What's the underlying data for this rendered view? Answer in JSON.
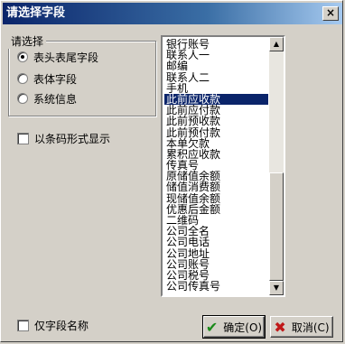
{
  "window": {
    "title": "请选择字段",
    "close_glyph": "×"
  },
  "group": {
    "title": "请选择",
    "options": [
      {
        "label": "表头表尾字段",
        "selected": true
      },
      {
        "label": "表体字段",
        "selected": false
      },
      {
        "label": "系统信息",
        "selected": false
      }
    ]
  },
  "barcode_checkbox": {
    "label": "以条码形式显示",
    "checked": false
  },
  "only_field_checkbox": {
    "label": "仅字段名称",
    "checked": false
  },
  "list": {
    "items": [
      "银行账号",
      "联系人一",
      "邮编",
      "联系人二",
      "手机",
      "此前应收款",
      "此前应付款",
      "此前预收款",
      "此前预付款",
      "本单欠款",
      "累积应收款",
      "传真号",
      "原储值余额",
      "储值消费额",
      "现储值余额",
      "优惠后金额",
      "二维码",
      "公司全名",
      "公司电话",
      "公司地址",
      "公司账号",
      "公司税号",
      "公司传真号"
    ],
    "selected_index": 5
  },
  "buttons": {
    "ok": {
      "label": "确定(O)",
      "icon": "check-icon"
    },
    "cancel": {
      "label": "取消(C)",
      "icon": "x-icon"
    }
  }
}
